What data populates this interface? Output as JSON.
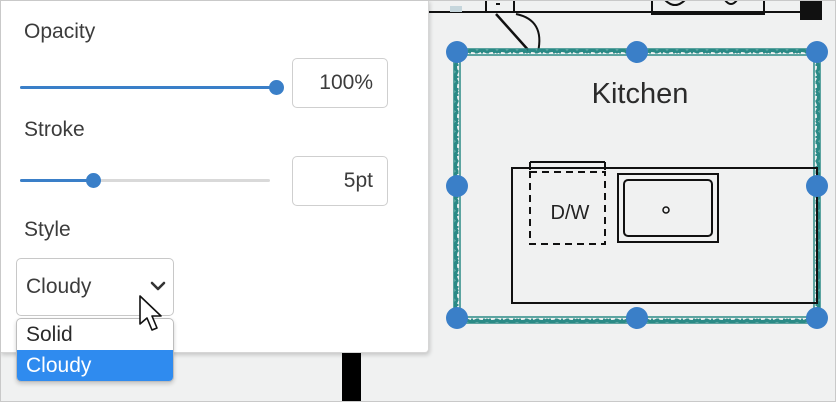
{
  "panel": {
    "opacity": {
      "label": "Opacity",
      "value_text": "100%",
      "level": 1.0
    },
    "stroke": {
      "label": "Stroke",
      "value_text": "5pt",
      "level": 0.29
    },
    "style": {
      "label": "Style",
      "selected": "Cloudy",
      "options": [
        "Solid",
        "Cloudy"
      ],
      "highlighted_option": "Cloudy"
    }
  },
  "canvas": {
    "room_label": "Kitchen",
    "appliance_label": "D/W",
    "selection_color": "#3a7fc8",
    "cloud_border_color": "#2a8a86"
  },
  "colors": {
    "accent": "#3a7fc8",
    "dropdown_highlight": "#2f8bef",
    "canvas_background": "#f0f1f1"
  }
}
